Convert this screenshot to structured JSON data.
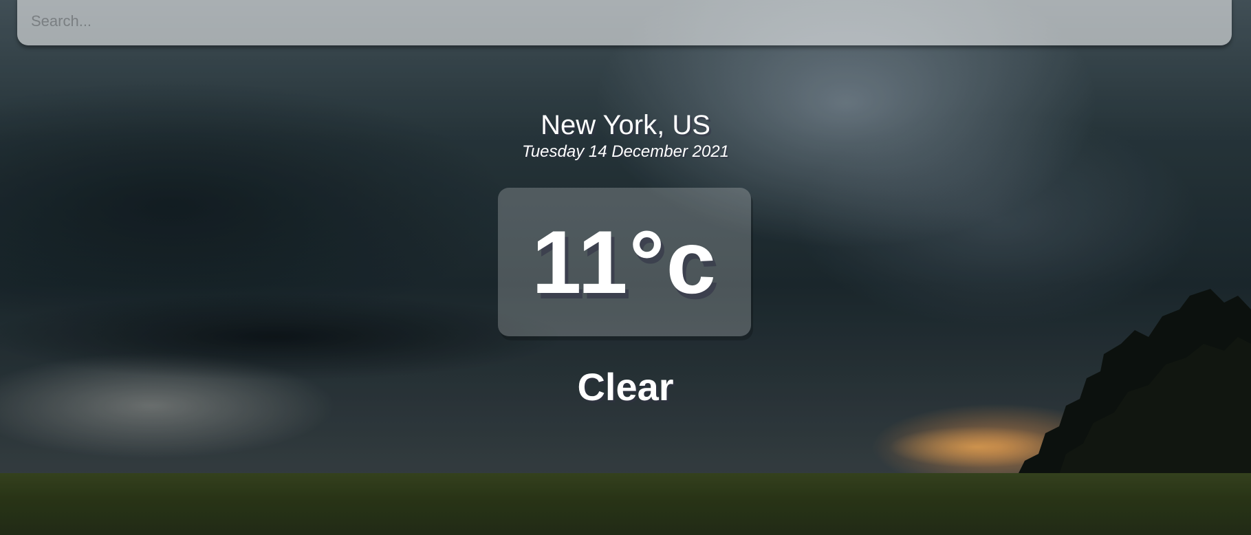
{
  "search": {
    "placeholder": "Search..."
  },
  "location": {
    "city": "New York, US",
    "date": "Tuesday 14 December 2021"
  },
  "weather": {
    "temperature": "11°c",
    "condition": "Clear"
  },
  "colors": {
    "text": "#ffffff",
    "search_background": "rgba(255,255,255,0.55)",
    "temp_box_background": "rgba(255,255,255,0.22)"
  },
  "background": {
    "scene": "storm-clouds-over-field"
  }
}
